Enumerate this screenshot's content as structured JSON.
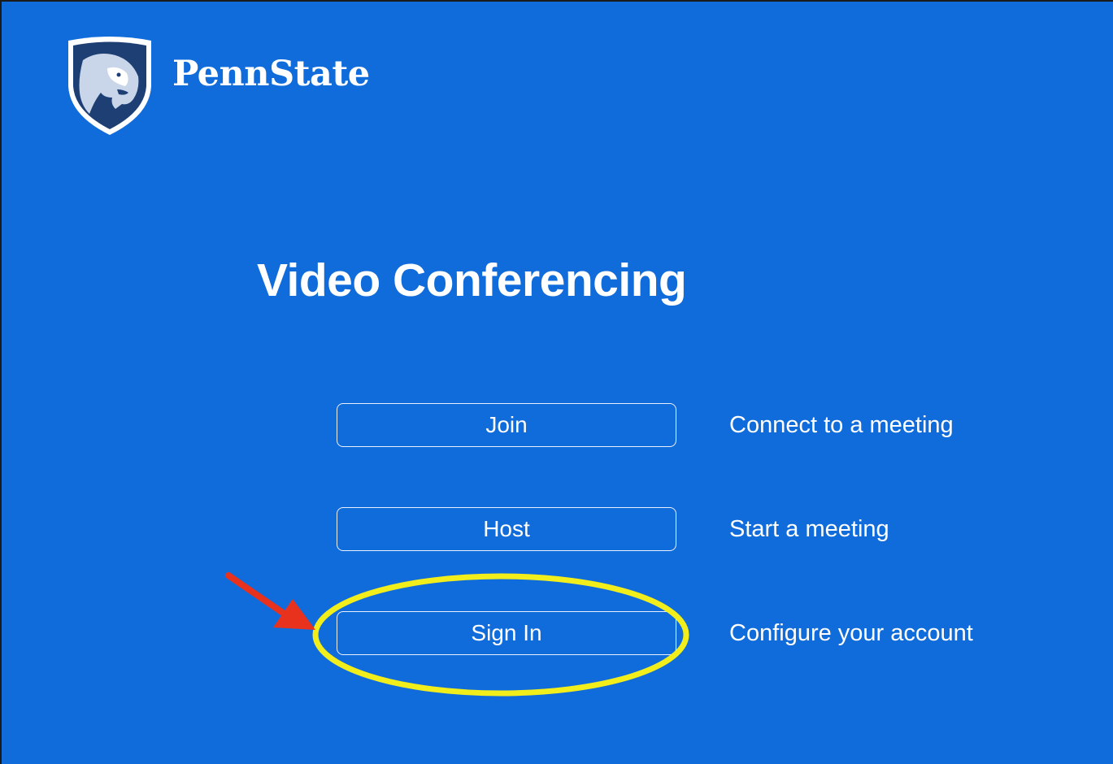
{
  "brand": {
    "name": "PennState",
    "logo_icon": "nittany-lion-shield-icon"
  },
  "page": {
    "title": "Video Conferencing"
  },
  "actions": [
    {
      "label": "Join",
      "description": "Connect to a meeting"
    },
    {
      "label": "Host",
      "description": "Start a meeting"
    },
    {
      "label": "Sign In",
      "description": "Configure your account"
    }
  ],
  "annotations": {
    "highlight_target": "Sign In",
    "arrow_color": "#e8321e",
    "ellipse_color": "#f2ee1c"
  },
  "colors": {
    "background": "#116cdb",
    "shield": "#1e3f74",
    "text": "#ffffff"
  }
}
